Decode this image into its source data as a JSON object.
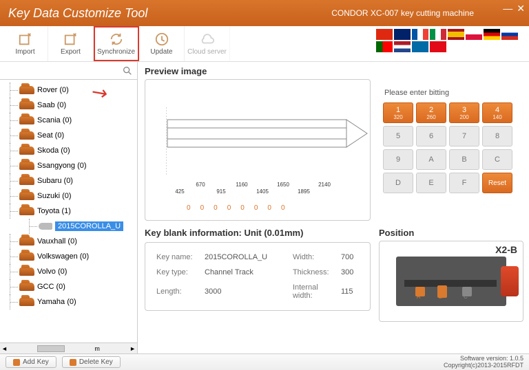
{
  "titlebar": {
    "title": "Key Data Customize Tool",
    "subtitle": "CONDOR XC-007 key cutting machine"
  },
  "toolbar": {
    "import": "Import",
    "export": "Export",
    "synchronize": "Synchronize",
    "update": "Update",
    "cloud": "Cloud server"
  },
  "tree": {
    "items": [
      {
        "label": "Rover (0)"
      },
      {
        "label": "Saab (0)"
      },
      {
        "label": "Scania (0)"
      },
      {
        "label": "Seat (0)"
      },
      {
        "label": "Skoda (0)"
      },
      {
        "label": "Ssangyong (0)"
      },
      {
        "label": "Subaru (0)"
      },
      {
        "label": "Suzuki (0)"
      },
      {
        "label": "Toyota (1)",
        "expanded": true,
        "child": {
          "label": "2015COROLLA_U",
          "selected": true
        }
      },
      {
        "label": "Vauxhall (0)"
      },
      {
        "label": "Volkswagen (0)"
      },
      {
        "label": "Volvo (0)"
      },
      {
        "label": "GCC (0)"
      },
      {
        "label": "Yamaha (0)"
      }
    ],
    "scroll_marker": "m"
  },
  "preview": {
    "heading": "Preview image",
    "ticks": [
      "425",
      "670",
      "915",
      "1160",
      "1405",
      "1650",
      "1895",
      "2140"
    ],
    "zeros": [
      "0",
      "0",
      "0",
      "0",
      "0",
      "0",
      "0",
      "0"
    ]
  },
  "bitting": {
    "label": "Please enter bitting",
    "keys": [
      {
        "label": "1",
        "sub": "320",
        "active": true
      },
      {
        "label": "2",
        "sub": "260",
        "active": true
      },
      {
        "label": "3",
        "sub": "200",
        "active": true
      },
      {
        "label": "4",
        "sub": "140",
        "active": true
      },
      {
        "label": "5"
      },
      {
        "label": "6"
      },
      {
        "label": "7"
      },
      {
        "label": "8"
      },
      {
        "label": "9"
      },
      {
        "label": "A"
      },
      {
        "label": "B"
      },
      {
        "label": "C"
      },
      {
        "label": "D"
      },
      {
        "label": "E"
      },
      {
        "label": "F"
      },
      {
        "label": "Reset",
        "active": true,
        "reset": true
      }
    ]
  },
  "blank": {
    "heading": "Key blank information: Unit (0.01mm)",
    "fields": {
      "key_name_k": "Key name:",
      "key_name_v": "2015COROLLA_U",
      "width_k": "Width:",
      "width_v": "700",
      "key_type_k": "Key type:",
      "key_type_v": "Channel Track",
      "thickness_k": "Thickness:",
      "thickness_v": "300",
      "length_k": "Length:",
      "length_v": "3000",
      "internal_k": "Internal width:",
      "internal_v": "115"
    }
  },
  "position": {
    "heading": "Position",
    "label": "X2-B",
    "a": "A",
    "b": "B",
    "c": "C"
  },
  "footer": {
    "add": "Add Key",
    "delete": "Delete Key",
    "version": "Software version: 1.0.5",
    "copyright": "Copyright(c)2013-2015RFDT"
  },
  "flags": [
    "cn",
    "uk",
    "fr",
    "it",
    "es",
    "pl",
    "de",
    "ru",
    "pt",
    "nl",
    "se",
    "tr"
  ],
  "flag_colors": {
    "cn": "#de2910",
    "uk": "#012169",
    "fr": "linear-gradient(90deg,#0055a4 33%,#fff 33% 66%,#ef4135 66%)",
    "it": "linear-gradient(90deg,#009246 33%,#fff 33% 66%,#ce2b37 66%)",
    "es": "linear-gradient(#aa151b 25%,#f1bf00 25% 75%,#aa151b 75%)",
    "pl": "linear-gradient(#fff 50%,#dc143c 50%)",
    "de": "linear-gradient(#000 33%,#dd0000 33% 66%,#ffce00 66%)",
    "ru": "linear-gradient(#fff 33%,#0039a6 33% 66%,#d52b1e 66%)",
    "pt": "linear-gradient(90deg,#006600 40%,#ff0000 40%)",
    "nl": "linear-gradient(#ae1c28 33%,#fff 33% 66%,#21468b 66%)",
    "se": "#006aa7",
    "tr": "#e30a17"
  }
}
